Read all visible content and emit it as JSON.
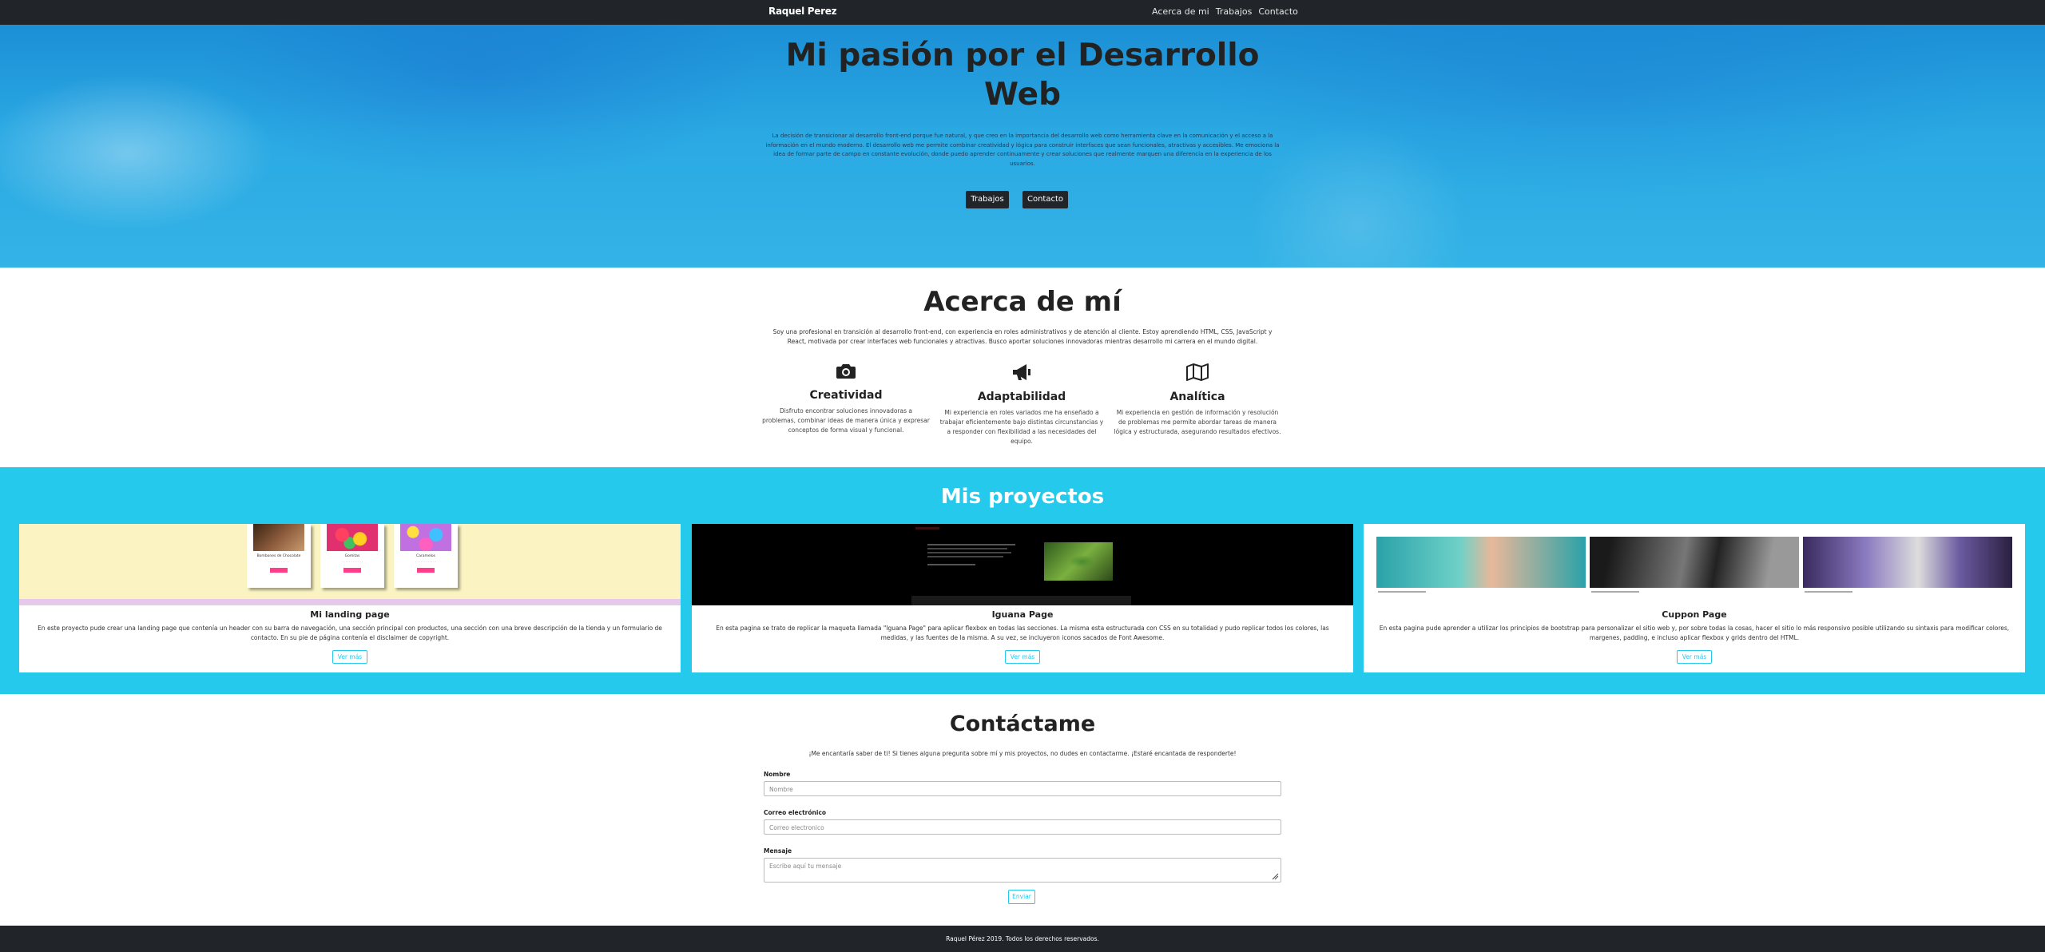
{
  "nav": {
    "brand": "Raquel Perez",
    "links": [
      "Acerca de mi",
      "Trabajos",
      "Contacto"
    ]
  },
  "hero": {
    "title": "Mi pasión por el Desarrollo Web",
    "text": "La decisión de transicionar al desarrollo front-end porque fue natural, y que creo en la importancia del desarrollo web como herramienta clave en la comunicación y el acceso a la información en el mundo moderno. El desarrollo web me permite combinar creatividad y lógica para construir interfaces que sean funcionales, atractivas y accesibles. Me emociona la idea de formar parte de campo en constante evolución, donde puedo aprender continuamente y crear soluciones que realmente marquen una diferencia en la experiencia de los usuarios.",
    "buttons": [
      "Trabajos",
      "Contacto"
    ]
  },
  "about": {
    "title": "Acerca de mí",
    "text": "Soy una profesional en transición al desarrollo front-end, con experiencia en roles administrativos y de atención al cliente. Estoy aprendiendo HTML, CSS, JavaScript y React, motivada por crear interfaces web funcionales y atractivas. Busco aportar soluciones innovadoras mientras desarrollo mi carrera en el mundo digital.",
    "features": [
      {
        "icon": "camera-icon",
        "title": "Creatividad",
        "text": "Disfruto encontrar soluciones innovadoras a problemas, combinar ideas de manera única y expresar conceptos de forma visual y funcional."
      },
      {
        "icon": "megaphone-icon",
        "title": "Adaptabilidad",
        "text": "Mi experiencia en roles variados me ha enseñado a trabajar eficientemente bajo distintas circunstancias y a responder con flexibilidad a las necesidades del equipo."
      },
      {
        "icon": "map-icon",
        "title": "Analítica",
        "text": "Mi experiencia en gestión de información y resolución de problemas me permite abordar tareas de manera lógica y estructurada, asegurando resultados efectivos."
      }
    ]
  },
  "projects": {
    "title": "Mis proyectos",
    "cards": [
      {
        "title": "Mi landing page",
        "text": "En este proyecto pude crear una landing page que contenía un header con su barra de navegación, una sección principal con productos, una sección con una breve descripción de la tienda y un formulario de contacto. En su pie de página contenía el disclaimer de copyright.",
        "button": "Ver más",
        "mini": [
          {
            "cap": "Bombones de Chocolate",
            "btn": "Comprar"
          },
          {
            "cap": "Gomitas",
            "btn": "Comprar"
          },
          {
            "cap": "Caramelos",
            "btn": "Comprar"
          }
        ]
      },
      {
        "title": "Iguana Page",
        "text": "En esta pagina se trato de replicar la maqueta llamada \"Iguana Page\" para aplicar flexbox en todas las secciones. La misma esta estructurada con CSS en su totalidad y pudo replicar todos los colores, las medidas, y las fuentes de la misma. A su vez, se incluyeron iconos sacados de Font Awesome.",
        "button": "Ver más"
      },
      {
        "title": "Cuppon Page",
        "text": "En esta pagina pude aprender a utilizar los principios de bootstrap para personalizar el sitio web y, por sobre todas la cosas, hacer el sitio lo más responsivo posible utilizando su sintaxis para modificar colores, margenes, padding, e incluso aplicar flexbox y grids dentro del HTML.",
        "button": "Ver más"
      }
    ]
  },
  "contact": {
    "title": "Contáctame",
    "text": "¡Me encantaría saber de ti! Si tienes alguna pregunta sobre mí y mis proyectos, no dudes en contactarme. ¡Estaré encantada de responderte!",
    "fields": [
      {
        "label": "Nombre",
        "placeholder": "Nombre"
      },
      {
        "label": "Correo electrónico",
        "placeholder": "Correo electronico"
      },
      {
        "label": "Mensaje",
        "placeholder": "Escribe aquí tu mensaje"
      }
    ],
    "submit": "Enviar"
  },
  "footer": {
    "text": "Raquel Pérez 2019. Todos los derechos reservados."
  }
}
